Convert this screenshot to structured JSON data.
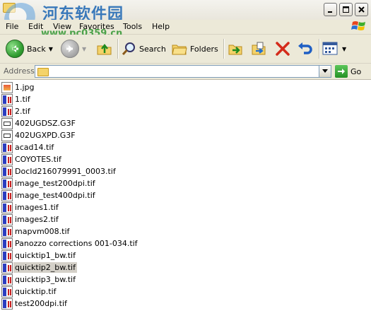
{
  "window": {
    "watermark_title": "河东软件园",
    "watermark_url": "www.pc0359.cn"
  },
  "menu": {
    "items": [
      "File",
      "Edit",
      "View",
      "Favorites",
      "Tools",
      "Help"
    ]
  },
  "toolbar": {
    "back_label": "Back",
    "search_label": "Search",
    "folders_label": "Folders"
  },
  "address": {
    "label": "Address",
    "value": "",
    "go_label": "Go"
  },
  "files": [
    {
      "name": "1.jpg",
      "type": "jpg"
    },
    {
      "name": "1.tif",
      "type": "tif"
    },
    {
      "name": "2.tif",
      "type": "tif"
    },
    {
      "name": "402UGDSZ.G3F",
      "type": "g3f"
    },
    {
      "name": "402UGXPD.G3F",
      "type": "g3f"
    },
    {
      "name": "acad14.tif",
      "type": "tif"
    },
    {
      "name": "COYOTES.tif",
      "type": "tif"
    },
    {
      "name": "DocId216079991_0003.tif",
      "type": "tif"
    },
    {
      "name": "image_test200dpi.tif",
      "type": "tif"
    },
    {
      "name": "image_test400dpi.tif",
      "type": "tif"
    },
    {
      "name": "images1.tif",
      "type": "tif"
    },
    {
      "name": "images2.tif",
      "type": "tif"
    },
    {
      "name": "mapvm008.tif",
      "type": "tif"
    },
    {
      "name": "Panozzo corrections 001-034.tif",
      "type": "tif"
    },
    {
      "name": "quicktip1_bw.tif",
      "type": "tif"
    },
    {
      "name": "quicktip2_bw.tif",
      "type": "tif",
      "selected": true
    },
    {
      "name": "quicktip3_bw.tif",
      "type": "tif"
    },
    {
      "name": "quicktip.tif",
      "type": "tif"
    },
    {
      "name": "test200dpi.tif",
      "type": "tif"
    }
  ]
}
